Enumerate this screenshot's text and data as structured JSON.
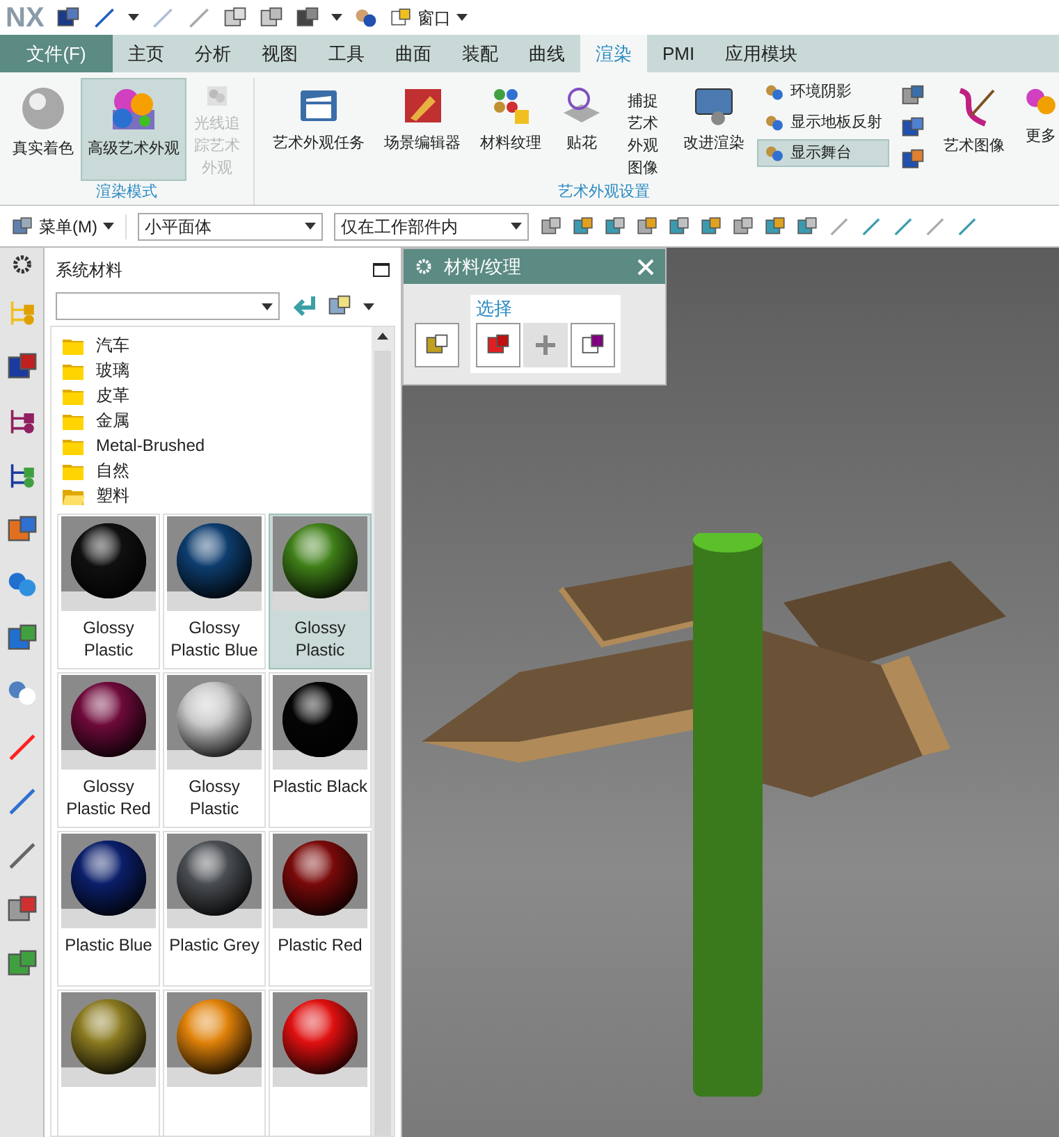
{
  "quick_access": {
    "logo": "NX",
    "window_menu": "窗口"
  },
  "tabs": [
    {
      "label": "文件(F)",
      "kind": "file",
      "selected": false
    },
    {
      "label": "主页",
      "kind": "tab",
      "selected": false
    },
    {
      "label": "分析",
      "kind": "tab",
      "selected": false
    },
    {
      "label": "视图",
      "kind": "tab",
      "selected": false
    },
    {
      "label": "工具",
      "kind": "tab",
      "selected": false
    },
    {
      "label": "曲面",
      "kind": "tab",
      "selected": false
    },
    {
      "label": "装配",
      "kind": "tab",
      "selected": false
    },
    {
      "label": "曲线",
      "kind": "tab",
      "selected": false
    },
    {
      "label": "渲染",
      "kind": "tab",
      "selected": true
    },
    {
      "label": "PMI",
      "kind": "tab",
      "selected": false
    },
    {
      "label": "应用模块",
      "kind": "tab",
      "selected": false
    }
  ],
  "ribbon": {
    "render_mode": {
      "title": "渲染模式",
      "buttons": [
        {
          "label": "真实着色",
          "selected": false,
          "disabled": false
        },
        {
          "label": "高级艺术外观",
          "selected": true,
          "disabled": false
        },
        {
          "label": "光线追踪艺术外观",
          "selected": false,
          "disabled": true
        }
      ]
    },
    "appearance": {
      "title": "艺术外观设置",
      "buttons": [
        {
          "label": "艺术外观任务"
        },
        {
          "label": "场景编辑器"
        },
        {
          "label": "材料纹理"
        },
        {
          "label": "贴花"
        },
        {
          "label": "捕捉艺术外观图像"
        },
        {
          "label": "改进渲染"
        }
      ],
      "toggles": [
        {
          "label": "环境阴影",
          "selected": false
        },
        {
          "label": "显示地板反射",
          "selected": false
        },
        {
          "label": "显示舞台",
          "selected": true
        }
      ],
      "art_image": "艺术图像",
      "more": "更多"
    }
  },
  "toolbar": {
    "menu": "菜单(M)",
    "filter": "小平面体",
    "scope": "仅在工作部件内"
  },
  "materials_panel": {
    "title": "系统材料",
    "folders": [
      {
        "label": "汽车",
        "expanded": false
      },
      {
        "label": "玻璃",
        "expanded": false
      },
      {
        "label": "皮革",
        "expanded": false
      },
      {
        "label": "金属",
        "expanded": false
      },
      {
        "label": "Metal-Brushed",
        "expanded": false
      },
      {
        "label": "自然",
        "expanded": false
      },
      {
        "label": "塑料",
        "expanded": true
      }
    ],
    "materials": [
      {
        "name": "Glossy Plastic",
        "color": "#101010",
        "selected": false
      },
      {
        "name": "Glossy Plastic Blue",
        "color": "#0d3d6e",
        "selected": false
      },
      {
        "name": "Glossy Plastic",
        "color": "#3f7f18",
        "selected": true
      },
      {
        "name": "Glossy Plastic Red",
        "color": "#6e0a3a",
        "selected": false
      },
      {
        "name": "Glossy Plastic",
        "color": "#c8c8c8",
        "selected": false
      },
      {
        "name": "Plastic Black",
        "color": "#050505",
        "selected": false
      },
      {
        "name": "Plastic Blue",
        "color": "#0b1f6a",
        "selected": false
      },
      {
        "name": "Plastic Grey",
        "color": "#4a4e52",
        "selected": false
      },
      {
        "name": "Plastic Red",
        "color": "#7a0a0a",
        "selected": false
      },
      {
        "color": "#8a7a20",
        "selected": false
      },
      {
        "color": "#e0820a",
        "selected": false
      },
      {
        "color": "#e01010",
        "selected": false
      }
    ]
  },
  "dialog": {
    "title": "材料/纹理",
    "select_label": "选择"
  }
}
